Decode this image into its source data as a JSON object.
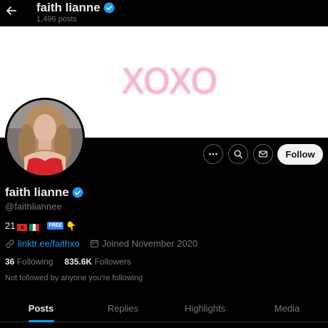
{
  "header": {
    "name": "faith lianne",
    "post_count": "1,496 posts"
  },
  "banner": {
    "text": "XOXO"
  },
  "actions": {
    "follow_label": "Follow"
  },
  "profile": {
    "display_name": "faith lianne",
    "handle": "@faithliannee",
    "bio_age": "21",
    "bio_badge": "FREE",
    "link": "linktr.ee/faithxo",
    "joined": "Joined November 2020",
    "following_count": "36",
    "following_label": "Following",
    "followers_count": "835.6K",
    "followers_label": "Followers",
    "not_followed": "Not followed by anyone you’re following"
  },
  "tabs": [
    {
      "label": "Posts",
      "active": true
    },
    {
      "label": "Replies",
      "active": false
    },
    {
      "label": "Highlights",
      "active": false
    },
    {
      "label": "Media",
      "active": false
    }
  ],
  "colors": {
    "accent": "#1d9bf0",
    "background": "#000000",
    "text_secondary": "#71767b"
  }
}
